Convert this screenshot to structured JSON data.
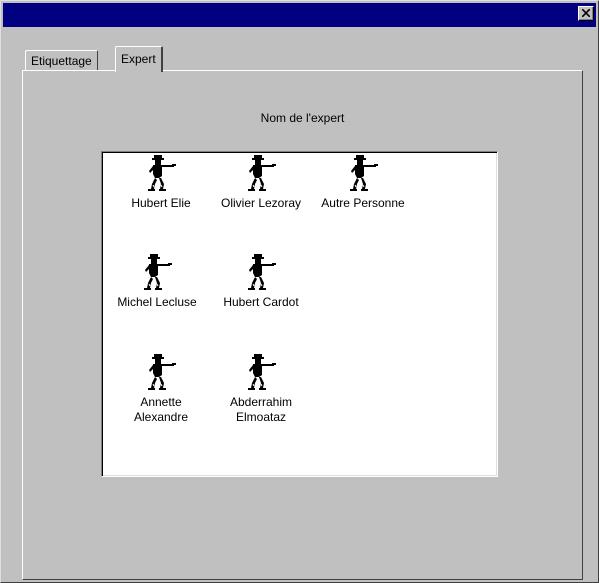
{
  "window": {
    "title": "",
    "close_icon": "close-icon"
  },
  "tabs": [
    {
      "label": "Etiquettage",
      "active": false
    },
    {
      "label": "Expert",
      "active": true
    }
  ],
  "panel": {
    "label": "Nom de l'expert"
  },
  "experts": [
    {
      "name": "Hubert Elie",
      "icon": "pointing-man-icon"
    },
    {
      "name": "Olivier Lezoray",
      "icon": "pointing-man-icon"
    },
    {
      "name": "Autre Personne",
      "icon": "pointing-man-icon"
    },
    {
      "name": "Michel Lecluse",
      "icon": "pointing-man-icon"
    },
    {
      "name": "Hubert Cardot",
      "icon": "pointing-man-icon"
    },
    {
      "name": "Annette\nAlexandre",
      "icon": "pointing-man-icon"
    },
    {
      "name": "Abderrahim\nElmoataz",
      "icon": "pointing-man-icon"
    }
  ],
  "colors": {
    "titlebar": "#000080",
    "face": "#c0c0c0",
    "list_background": "#ffffff"
  }
}
